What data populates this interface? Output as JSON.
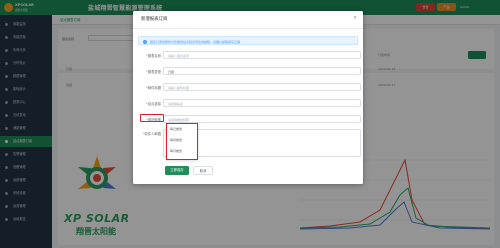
{
  "header": {
    "logo_text": "XPSOLAR",
    "logo_sub": "鑫鹏太阳能",
    "system_title": "盐城翔晋智慧能源管理系统",
    "badge_1": "告警",
    "badge_2": "产品",
    "user": "admin"
  },
  "sidebar": {
    "items": [
      {
        "label": "用能监测"
      },
      {
        "label": "电能质量"
      },
      {
        "label": "负荷分析"
      },
      {
        "label": "分时电价"
      },
      {
        "label": "数据管理"
      },
      {
        "label": "能耗统计"
      },
      {
        "label": "报表中心"
      },
      {
        "label": "光伏发电"
      },
      {
        "label": "储能管理"
      },
      {
        "label": "站点报表订阅"
      },
      {
        "label": "告警管理"
      },
      {
        "label": "设备管理"
      },
      {
        "label": "运维管理"
      },
      {
        "label": "系统设置"
      },
      {
        "label": "运营管理"
      },
      {
        "label": "运维报告"
      }
    ]
  },
  "page": {
    "tab_label": "站点报表订阅"
  },
  "background": {
    "col_name": "报表名称",
    "col_time": "订阅时间",
    "row1_a": "日报",
    "row1_b": "2020-09-18",
    "row2_a": "月报",
    "row2_b": "2020-09-17"
  },
  "watermark": {
    "brand": "XP SOLAR",
    "brand_cn": "翔晋太阳能"
  },
  "dialog": {
    "title": "新增报表订阅",
    "close_symbol": "×",
    "notice": "报表订阅将按时为您推送站点报表到您的邮箱，请确认邮箱填写正确",
    "fields": {
      "report_name": {
        "label": "报表名称",
        "placeholder": "请输入报表名称"
      },
      "report_type": {
        "label": "报表类型",
        "value": "日报"
      },
      "email_title": {
        "label": "邮件标题",
        "placeholder": "请输入邮件标题"
      },
      "site": {
        "label": "站点选择",
        "placeholder": "请选择站点"
      },
      "frequency": {
        "label": "推送频率",
        "placeholder": "请选择推送频率"
      },
      "recipients": {
        "label": "收件人邮箱"
      }
    },
    "frequency_options": [
      "每日推送",
      "每周推送",
      "每月推送"
    ],
    "confirm_label": "立即保存",
    "cancel_label": "取消"
  }
}
